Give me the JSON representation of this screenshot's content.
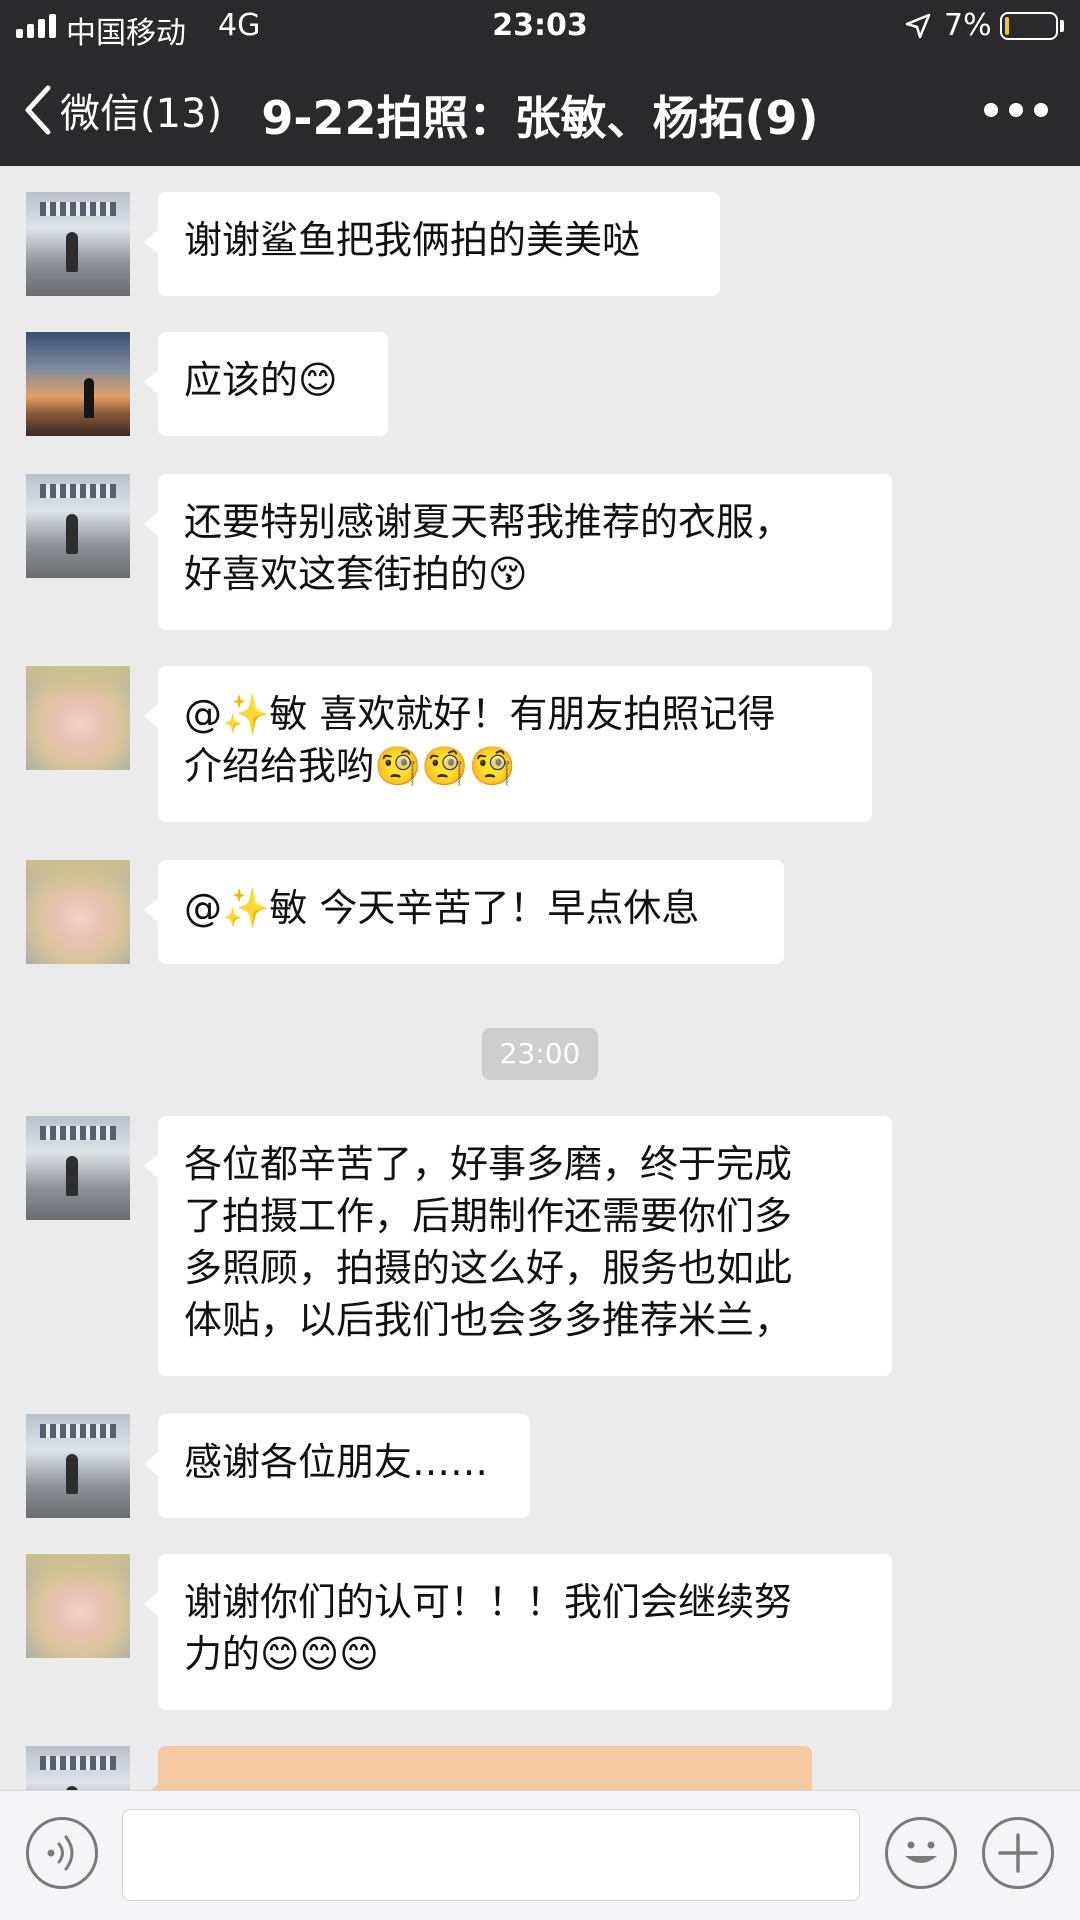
{
  "status_bar": {
    "carrier": "中国移动",
    "network": "4G",
    "time": "23:03",
    "battery_percent_label": "7%",
    "battery_level": 0.07
  },
  "nav": {
    "back_label": "微信(13)",
    "title": "9-22拍照：张敏、杨拓(9)"
  },
  "messages": [
    {
      "avatar": "store-photo-avatar",
      "text": "谢谢鲨鱼把我俩拍的美美哒"
    },
    {
      "avatar": "sunset-silhouette-avatar",
      "text": "应该的😊"
    },
    {
      "avatar": "store-photo-avatar",
      "text": "还要特别感谢夏天帮我推荐的衣服，\n好喜欢这套街拍的😚"
    },
    {
      "avatar": "girl-selfie-avatar",
      "text": "@✨敏 喜欢就好！有朋友拍照记得\n介绍给我哟🧐🧐🧐"
    },
    {
      "avatar": "girl-selfie-avatar",
      "text": "@✨敏 今天辛苦了！早点休息"
    },
    {
      "avatar": "store-photo-avatar",
      "text": "各位都辛苦了，好事多磨，终于完成\n了拍摄工作，后期制作还需要你们多\n多照顾，拍摄的这么好，服务也如此\n体贴，以后我们也会多多推荐米兰，"
    },
    {
      "avatar": "store-photo-avatar",
      "text": "感谢各位朋友……"
    },
    {
      "avatar": "girl-selfie-avatar",
      "text": "谢谢你们的认可！！！我们会继续努\n力的😊😊😊"
    },
    {
      "avatar": "store-photo-avatar",
      "text": ""
    }
  ],
  "timestamp": "23:00",
  "input": {
    "value": "",
    "placeholder": ""
  },
  "icons": {
    "signal": "signal-bars-icon",
    "location": "location-arrow-icon",
    "battery": "battery-icon",
    "back": "chevron-left-icon",
    "more": "more-dots-icon",
    "voice": "voice-icon",
    "emoji": "emoji-icon",
    "plus": "plus-icon"
  },
  "colors": {
    "nav_background": "#2a2a2c",
    "chat_background": "#ebebeb",
    "bubble": "#ffffff",
    "battery_low": "#f4c430"
  }
}
